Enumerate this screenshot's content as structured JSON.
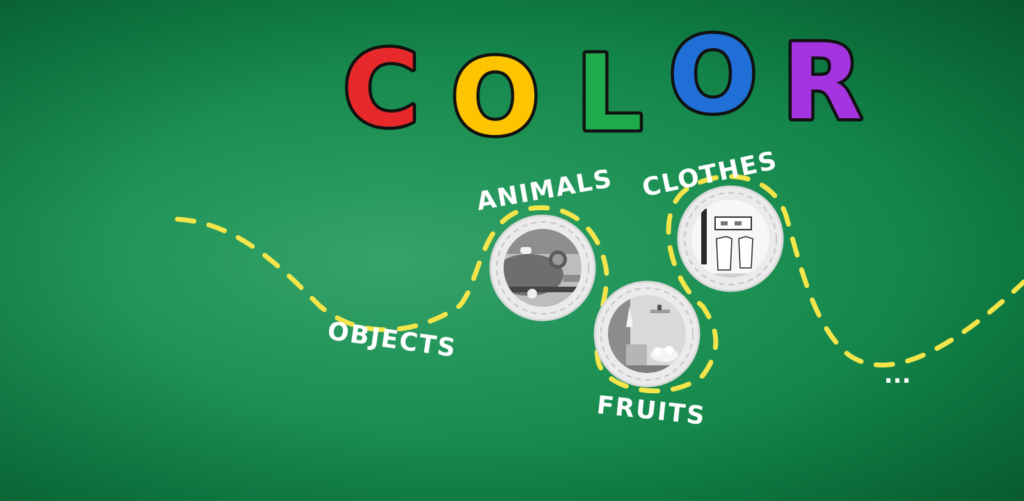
{
  "title": {
    "letters": [
      "C",
      "O",
      "L",
      "O",
      "R"
    ],
    "colors": [
      "#e8292b",
      "#ffc400",
      "#1faa4b",
      "#1f6fd6",
      "#a334e0"
    ]
  },
  "categories": [
    {
      "label": "OBJECTS",
      "icon": "objects-scene-icon"
    },
    {
      "label": "ANIMALS",
      "icon": "animals-scene-icon"
    },
    {
      "label": "FRUITS",
      "icon": "fruits-scene-icon"
    },
    {
      "label": "CLOTHES",
      "icon": "clothes-scene-icon"
    }
  ],
  "more_label": "...",
  "colors": {
    "background": "#1f9256",
    "path_dash": "#f4e54a",
    "ring": "#e9e9e9",
    "scene_gray": "#9a9a9a"
  }
}
